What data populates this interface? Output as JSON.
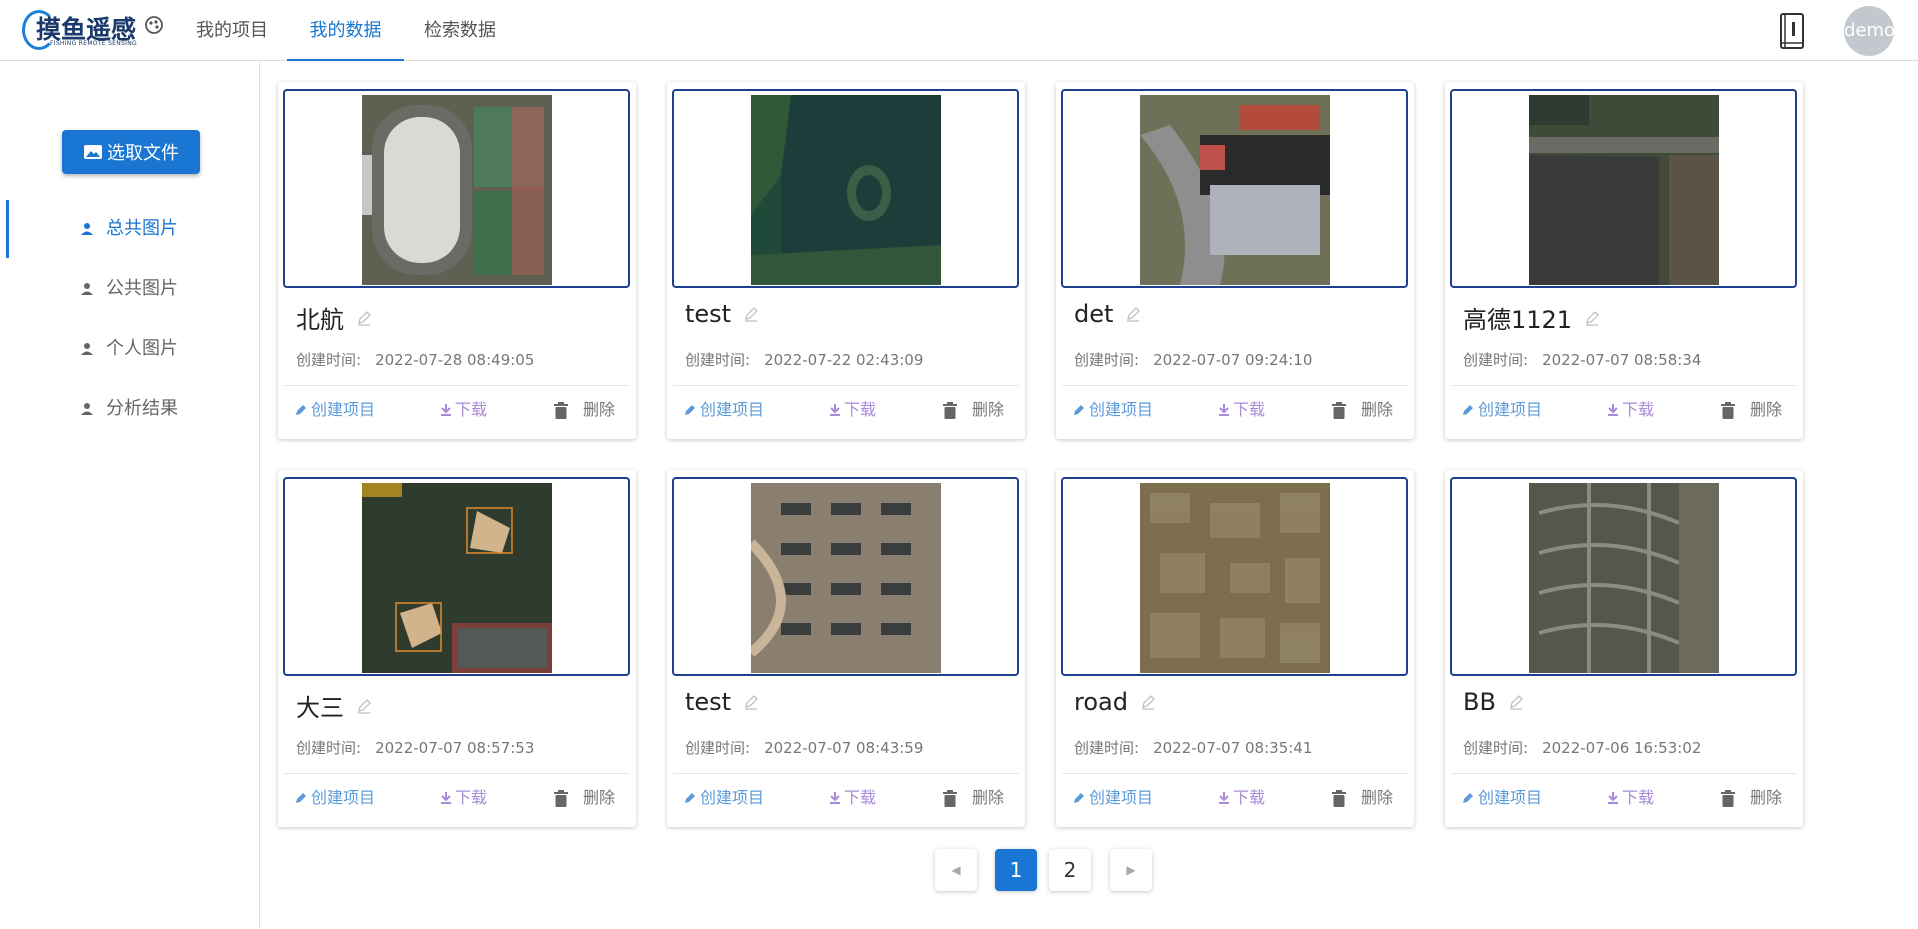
{
  "header": {
    "logo_text": "摸鱼遥感",
    "logo_subtitle": "FISHING REMOTE SENSING",
    "tabs": [
      {
        "label": "我的项目"
      },
      {
        "label": "我的数据"
      },
      {
        "label": "检索数据"
      }
    ],
    "active_tab": 1,
    "avatar_text": "demo"
  },
  "sidebar": {
    "upload_label": "选取文件",
    "items": [
      {
        "label": "总共图片"
      },
      {
        "label": "公共图片"
      },
      {
        "label": "个人图片"
      },
      {
        "label": "分析结果"
      }
    ],
    "active_item": 0
  },
  "card_labels": {
    "time_label": "创建时间:",
    "create": "创建项目",
    "download": "下载",
    "delete": "删除"
  },
  "cards": [
    {
      "title": "北航",
      "time": "2022-07-28 08:49:05",
      "thumb": "stadium"
    },
    {
      "title": "test",
      "time": "2022-07-22 02:43:09",
      "thumb": "lake-forest"
    },
    {
      "title": "det",
      "time": "2022-07-07 09:24:10",
      "thumb": "highway-building"
    },
    {
      "title": "高德1121",
      "time": "2022-07-07 08:58:34",
      "thumb": "pond-road"
    },
    {
      "title": "大三",
      "time": "2022-07-07 08:57:53",
      "thumb": "baseball-fields"
    },
    {
      "title": "test",
      "time": "2022-07-07 08:43:59",
      "thumb": "residential-blocks"
    },
    {
      "title": "road",
      "time": "2022-07-07 08:35:41",
      "thumb": "dense-village"
    },
    {
      "title": "BB",
      "time": "2022-07-06 16:53:02",
      "thumb": "suburb-streets"
    }
  ],
  "pagination": {
    "prev": "◀",
    "pages": [
      "1",
      "2"
    ],
    "current": "1",
    "next": "▶"
  },
  "colors": {
    "accent": "#1976d2",
    "frame": "#1e3f8f",
    "create": "#5c9bd9",
    "download": "#a88bd8"
  }
}
